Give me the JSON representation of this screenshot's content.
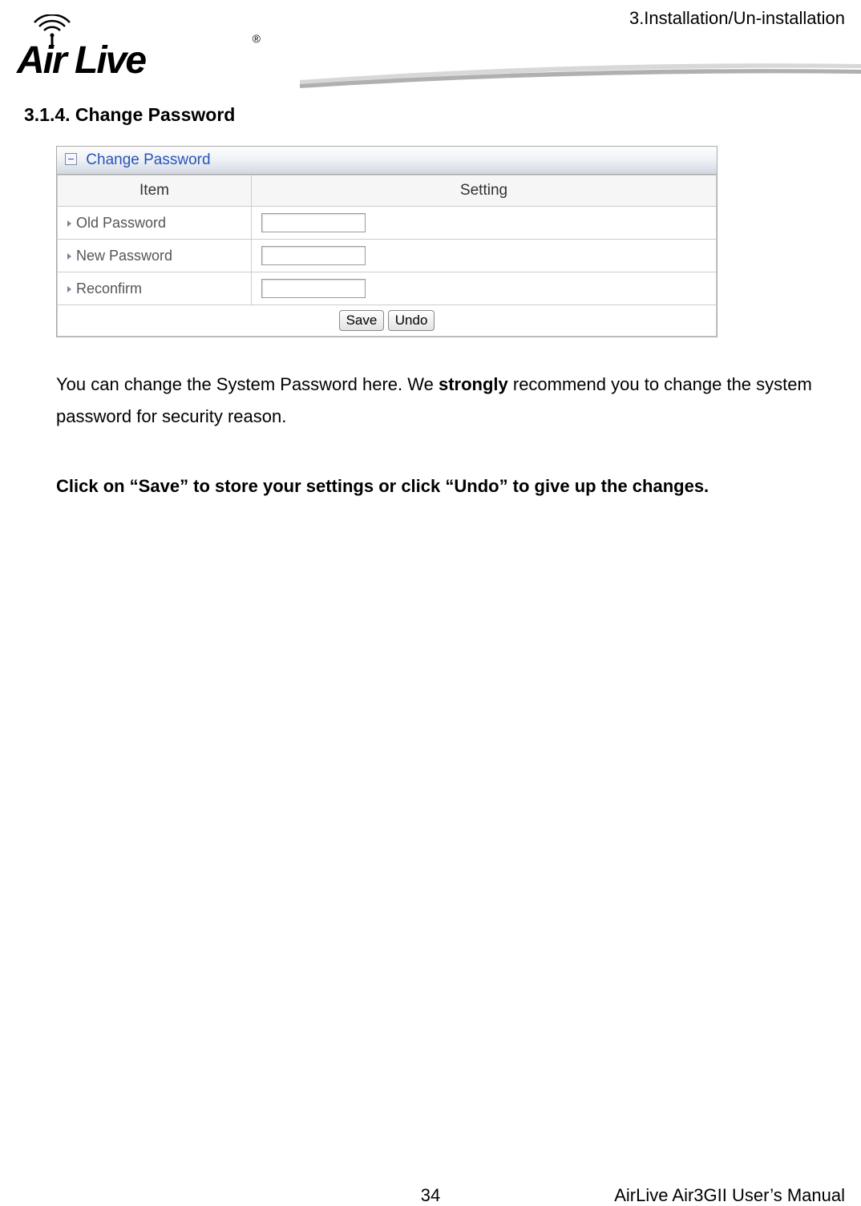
{
  "header": {
    "chapter_ref": "3.Installation/Un-installation",
    "brand_logo_text": "Air Live",
    "brand_logo_alt": "AirLive logo",
    "registered_mark": "®"
  },
  "section": {
    "number_title": "3.1.4. Change Password"
  },
  "panel": {
    "title": "Change Password",
    "col_item": "Item",
    "col_setting": "Setting",
    "rows": [
      {
        "label": "Old Password",
        "value": ""
      },
      {
        "label": "New Password",
        "value": ""
      },
      {
        "label": "Reconfirm",
        "value": ""
      }
    ],
    "buttons": {
      "save": "Save",
      "undo": "Undo"
    }
  },
  "body": {
    "p1_a": "You can change the System Password here. We ",
    "p1_b_strong": "strongly",
    "p1_c": " recommend you to change the system password for security reason.",
    "p2": "Click on “Save” to store your settings or click “Undo” to give up the changes."
  },
  "footer": {
    "page_number": "34",
    "manual_title": "AirLive Air3GII User’s Manual"
  }
}
